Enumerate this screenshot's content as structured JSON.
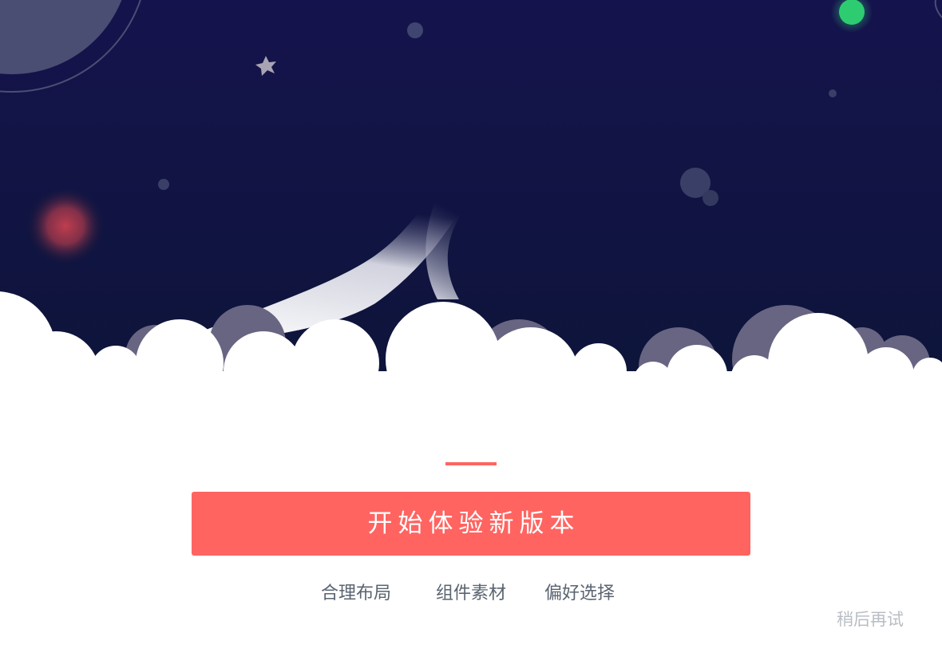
{
  "hero": {
    "colors": {
      "sky_top": "#15134d",
      "sky_bottom": "#0d1538",
      "planet": "#4a4e73",
      "green_dot": "#2ecc71",
      "red_glow": "#c8404f",
      "back_clouds": "#686582",
      "clouds": "#ffffff",
      "star": "#a9a4b3"
    },
    "icons": [
      "planet-icon",
      "star-icon",
      "green-dot-icon",
      "red-glow-icon",
      "cloud-icon"
    ]
  },
  "main": {
    "accent_color": "#ff6461",
    "cta_label": "开始体验新版本"
  },
  "features": [
    {
      "label": "合理布局"
    },
    {
      "label": "组件素材"
    },
    {
      "label": "偏好选择"
    }
  ],
  "footer": {
    "later_label": "稍后再试"
  }
}
